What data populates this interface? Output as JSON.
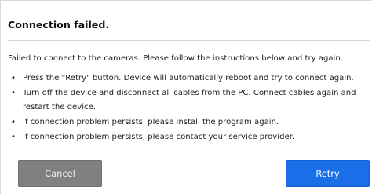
{
  "dialog": {
    "title": "Connection failed.",
    "intro": "Failed to connect to the cameras. Please follow the instructions below and try again.",
    "bullets": [
      "Press the \"Retry\" button. Device will automatically reboot and try to connect again.",
      "Turn off the device and disconnect all cables from the PC. Connect cables again and restart the device.",
      "If connection problem persists, please install the program again.",
      "If connection problem persists, please contact your service provider."
    ],
    "bullet_glyph": "•",
    "buttons": {
      "cancel_label": "Cancel",
      "retry_label": "Retry"
    }
  },
  "colors": {
    "cancel_bg": "#808080",
    "retry_bg": "#1a6fe8"
  }
}
